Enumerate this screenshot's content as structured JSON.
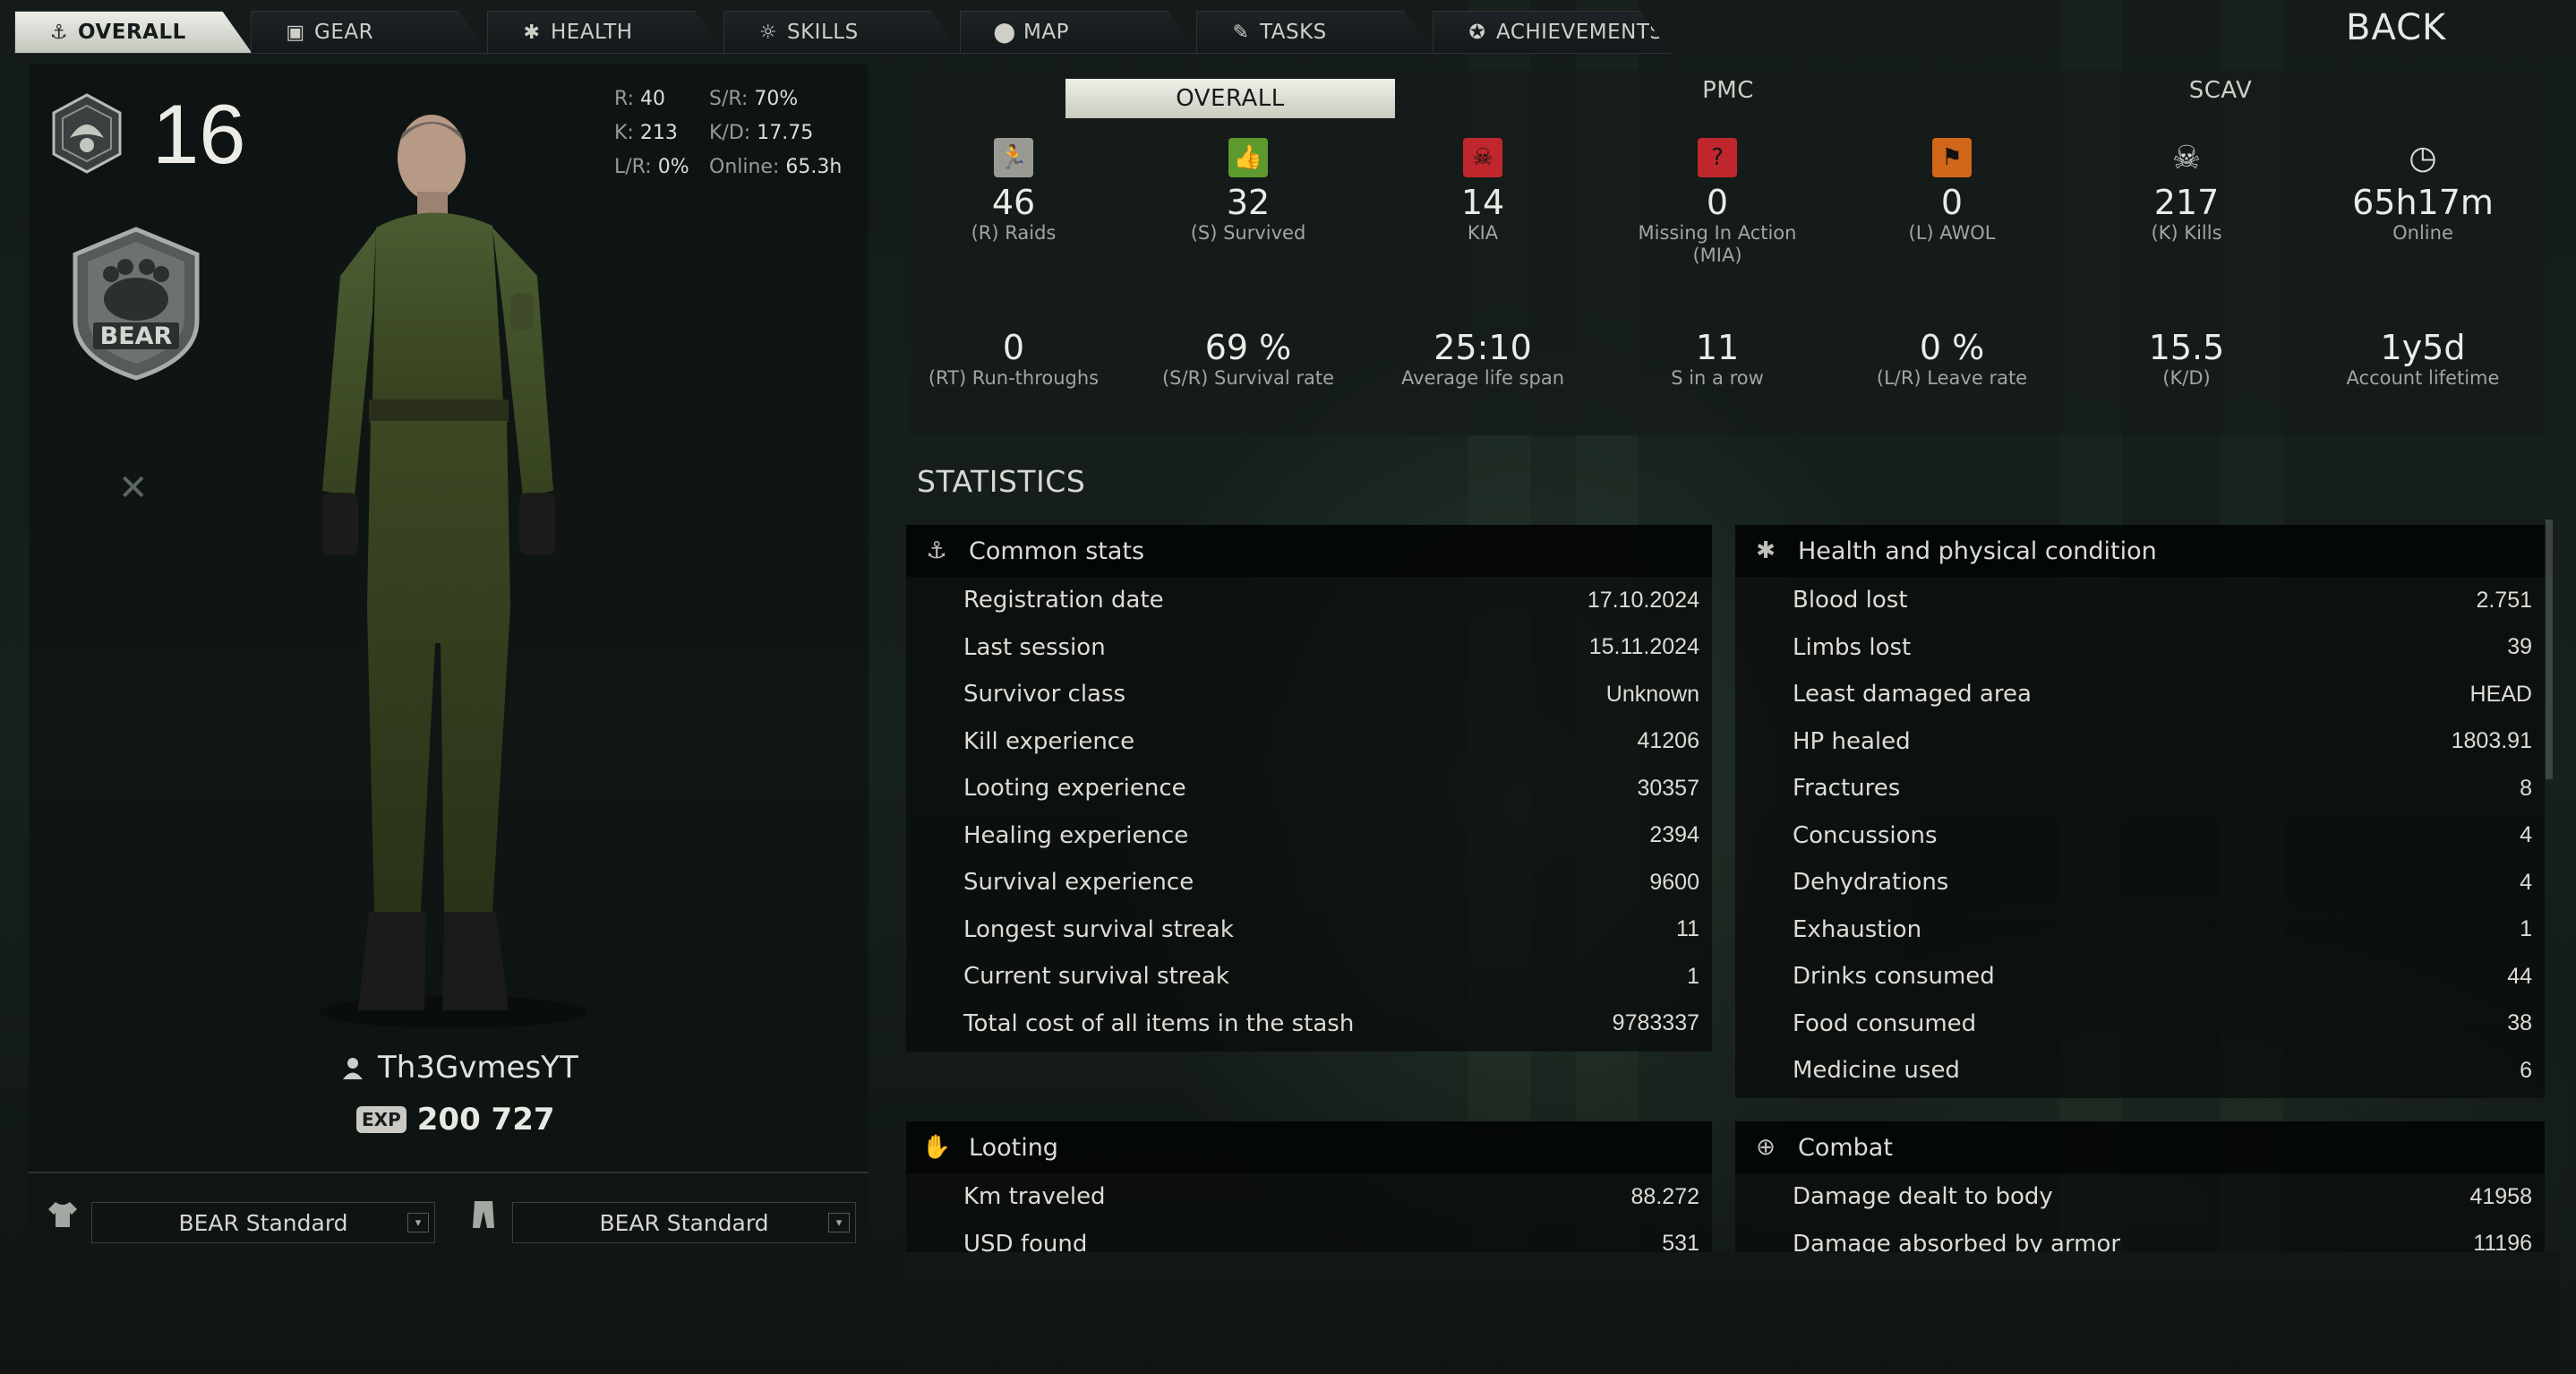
{
  "nav": {
    "tabs": [
      {
        "label": "OVERALL",
        "icon": "anchor-icon",
        "active": true
      },
      {
        "label": "GEAR",
        "icon": "vest-icon"
      },
      {
        "label": "HEALTH",
        "icon": "health-icon"
      },
      {
        "label": "SKILLS",
        "icon": "bulb-icon"
      },
      {
        "label": "MAP",
        "icon": "map-pin-icon"
      },
      {
        "label": "TASKS",
        "icon": "tasks-icon"
      },
      {
        "label": "ACHIEVEMENTS",
        "icon": "achievements-icon"
      }
    ],
    "back": "BACK"
  },
  "profile": {
    "level": "16",
    "faction_emblem_text": "BEAR",
    "quick_stats": {
      "r_label": "R:",
      "r": "40",
      "sr_label": "S/R:",
      "sr": "70%",
      "k_label": "K:",
      "k": "213",
      "kd_label": "K/D:",
      "kd": "17.75",
      "lr_label": "L/R:",
      "lr": "0%",
      "online_label": "Online:",
      "online": "65.3h"
    },
    "nickname": "Th3GvmesYT",
    "exp_badge": "EXP",
    "exp": "200 727",
    "loadout": {
      "top": "BEAR Standard",
      "bottom": "BEAR Standard"
    }
  },
  "modes": {
    "overall": "OVERALL",
    "pmc": "PMC",
    "scav": "SCAV"
  },
  "summary": {
    "row1": [
      {
        "value": "46",
        "label": "(R) Raids",
        "icon": "raid-icon",
        "color": "#9a9a94"
      },
      {
        "value": "32",
        "label": "(S) Survived",
        "icon": "thumbs-up-icon",
        "color": "#5d9a2e"
      },
      {
        "value": "14",
        "label": "KIA",
        "icon": "skull-icon",
        "color": "#c0272d"
      },
      {
        "value": "0",
        "label": "Missing In Action\n(MIA)",
        "icon": "question-icon",
        "color": "#c0272d"
      },
      {
        "value": "0",
        "label": "(L) AWOL",
        "icon": "awol-icon",
        "color": "#d1651a"
      },
      {
        "value": "217",
        "label": "(K) Kills",
        "icon": "skull-crossbones-icon",
        "color": "#cfcfca"
      },
      {
        "value": "65h17m",
        "label": "Online",
        "icon": "clock-icon",
        "color": "#cfcfca"
      }
    ],
    "row2": [
      {
        "value": "0",
        "label": "(RT) Run-throughs"
      },
      {
        "value": "69 %",
        "label": "(S/R) Survival rate"
      },
      {
        "value": "25:10",
        "label": "Average life span"
      },
      {
        "value": "11",
        "label": "S in a row"
      },
      {
        "value": "0 %",
        "label": "(L/R) Leave rate"
      },
      {
        "value": "15.5",
        "label": "(K/D)"
      },
      {
        "value": "1y5d",
        "label": "Account lifetime"
      }
    ]
  },
  "statistics": {
    "title": "STATISTICS",
    "common": {
      "title": "Common stats",
      "rows": [
        {
          "k": "Registration date",
          "v": "17.10.2024"
        },
        {
          "k": "Last session",
          "v": "15.11.2024"
        },
        {
          "k": "Survivor class",
          "v": "Unknown"
        },
        {
          "k": "Kill experience",
          "v": "41206"
        },
        {
          "k": "Looting experience",
          "v": "30357"
        },
        {
          "k": "Healing experience",
          "v": "2394"
        },
        {
          "k": "Survival experience",
          "v": "9600"
        },
        {
          "k": "Longest survival streak",
          "v": "11"
        },
        {
          "k": "Current survival streak",
          "v": "1"
        },
        {
          "k": "Total cost of all items in the stash",
          "v": "9783337"
        }
      ]
    },
    "health": {
      "title": "Health and physical condition",
      "rows": [
        {
          "k": "Blood lost",
          "v": "2.751"
        },
        {
          "k": "Limbs lost",
          "v": "39"
        },
        {
          "k": "Least damaged area",
          "v": "HEAD"
        },
        {
          "k": "HP healed",
          "v": "1803.91"
        },
        {
          "k": "Fractures",
          "v": "8"
        },
        {
          "k": "Concussions",
          "v": "4"
        },
        {
          "k": "Dehydrations",
          "v": "4"
        },
        {
          "k": "Exhaustion",
          "v": "1"
        },
        {
          "k": "Drinks consumed",
          "v": "44"
        },
        {
          "k": "Food consumed",
          "v": "38"
        },
        {
          "k": "Medicine used",
          "v": "6"
        }
      ]
    },
    "looting": {
      "title": "Looting",
      "rows": [
        {
          "k": "Km traveled",
          "v": "88.272"
        },
        {
          "k": "USD found",
          "v": "531"
        }
      ]
    },
    "combat": {
      "title": "Combat",
      "rows": [
        {
          "k": "Damage dealt to body",
          "v": "41958"
        },
        {
          "k": "Damage absorbed by armor",
          "v": "11196"
        }
      ]
    }
  }
}
